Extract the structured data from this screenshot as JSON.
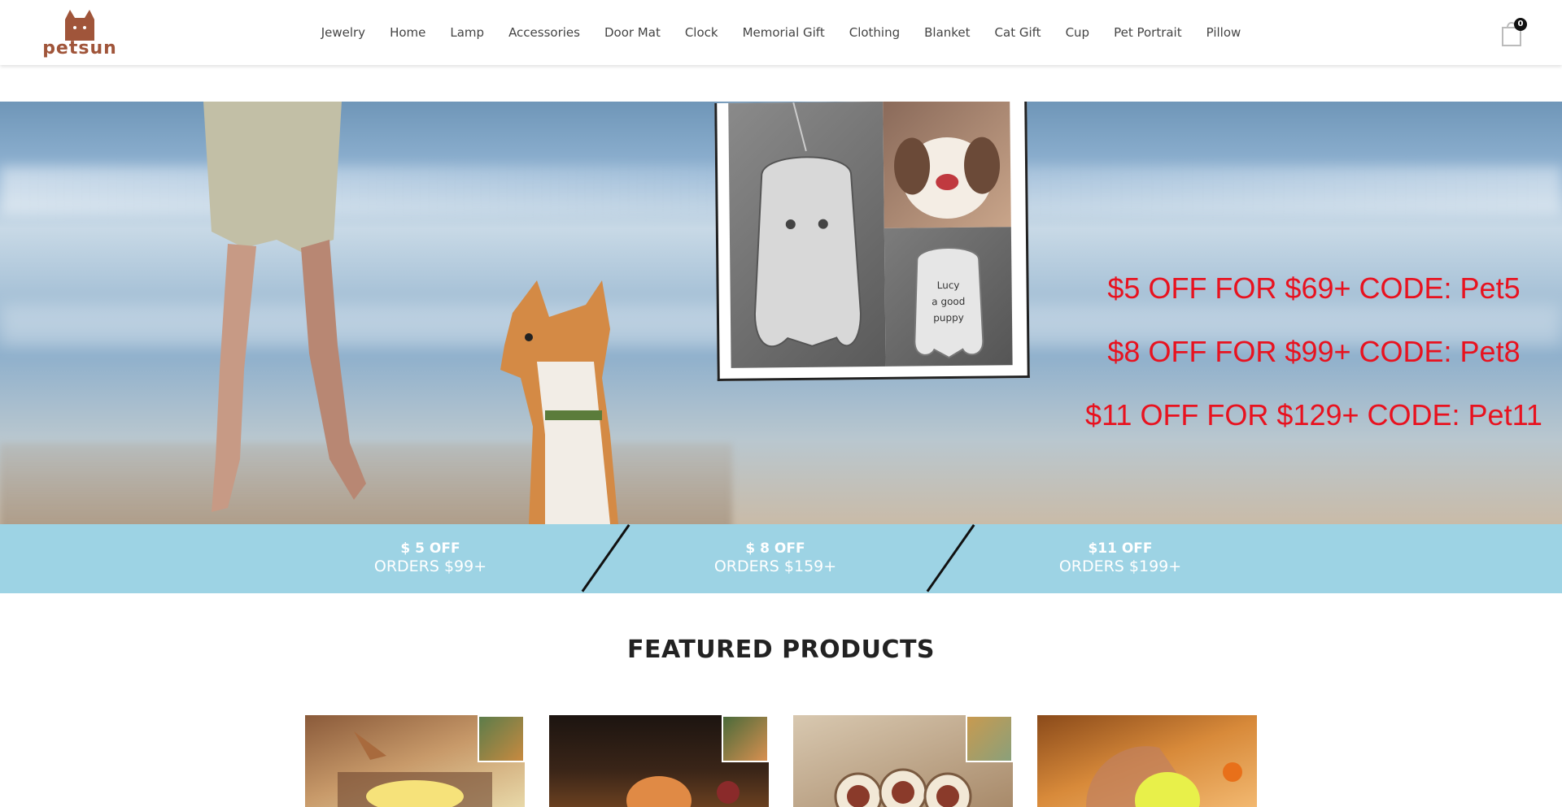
{
  "header": {
    "logo_text": "petsun",
    "nav": [
      "Jewelry",
      "Home",
      "Lamp",
      "Accessories",
      "Door Mat",
      "Clock",
      "Memorial Gift",
      "Clothing",
      "Blanket",
      "Cat Gift",
      "Cup",
      "Pet Portrait",
      "Pillow"
    ],
    "cart_count": "0"
  },
  "hero": {
    "promo_lines": [
      "$5  OFF FOR $69+  CODE: Pet5",
      "$8 OFF FOR $99+  CODE: Pet8",
      "$11 OFF FOR $129+  CODE: Pet11"
    ],
    "pendant_text": "Lucy a good puppy"
  },
  "offers": [
    {
      "top": "$ 5 OFF",
      "bottom": "ORDERS $99+"
    },
    {
      "top": "$ 8 OFF",
      "bottom": "ORDERS $159+"
    },
    {
      "top": "$11 OFF",
      "bottom": "ORDERS $199+"
    }
  ],
  "featured": {
    "title": "FEATURED PRODUCTS"
  },
  "colors": {
    "promo_red": "#e8121f",
    "offer_band": "#9dd3e4",
    "logo_brown": "#a0553a"
  }
}
